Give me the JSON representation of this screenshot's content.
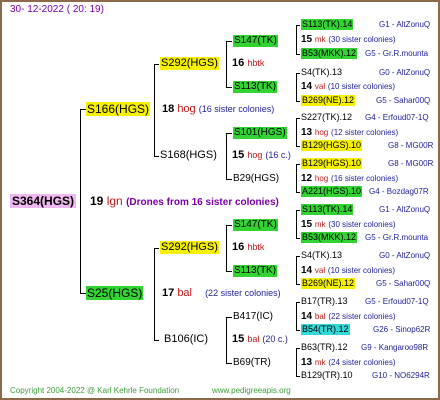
{
  "header": {
    "date": "30- 12-2022 ( 20: 19)"
  },
  "footer": {
    "copyright": "Copyright 2004-2022 @ Karl Kehrle Foundation",
    "website": "www.pedigreeapis.org"
  },
  "root": {
    "id": "S364(HGS)",
    "gen": "19",
    "code": "lgn",
    "note": "(Drones from 16 sister colonies)"
  },
  "gen1": [
    {
      "id": "S166(HGS)",
      "num": "18",
      "code": "hog",
      "note": "(16 sister colonies)"
    },
    {
      "id": "S25(HGS)",
      "num": "17",
      "code": "bal",
      "note": "(22 sister colonies)"
    }
  ],
  "gen2": [
    {
      "id": "S292(HGS)",
      "num": "16",
      "code": "hbtk",
      "note": ""
    },
    {
      "id": "S168(HGS)",
      "num": "15",
      "code": "hog",
      "note": "(16 c.)"
    },
    {
      "id": "S292(HGS)",
      "num": "16",
      "code": "hbtk",
      "note": ""
    },
    {
      "id": "B106(IC)",
      "num": "15",
      "code": "bal",
      "note": "(20 c.)"
    }
  ],
  "gen3": [
    {
      "id": "S147(TK)",
      "num": "15",
      "code": "mk",
      "note": "(30 sister colonies)"
    },
    {
      "id": "S113(TK)",
      "num": "14",
      "code": "val",
      "note": "(10 sister colonies)"
    },
    {
      "id": "S101(HGS)",
      "num": "13",
      "code": "hog",
      "note": "(12 sister colonies)"
    },
    {
      "id": "B29(HGS)",
      "num": "12",
      "code": "hog",
      "note": "(16 sister colonies)"
    },
    {
      "id": "S147(TK)",
      "num": "15",
      "code": "mk",
      "note": "(30 sister colonies)"
    },
    {
      "id": "S113(TK)",
      "num": "14",
      "code": "val",
      "note": "(10 sister colonies)"
    },
    {
      "id": "B417(IC)",
      "num": "14",
      "code": "bal",
      "note": "(22 sister colonies)"
    },
    {
      "id": "B69(TR)",
      "num": "13",
      "code": "mk",
      "note": "(24 sister colonies)"
    }
  ],
  "gen4": [
    {
      "id": "S113(TK).14",
      "right": "G1 - AltZonuQ"
    },
    {
      "id": "B53(MKK).12",
      "right": "G5 - Gr.R.mounta"
    },
    {
      "id": "S4(TK).13",
      "right": "G0 - AltZonuQ"
    },
    {
      "id": "B269(NE).12",
      "right": "G5 - Sahar00Q"
    },
    {
      "id": "S227(TK).12",
      "right": "G4 - Erfoud07-1Q"
    },
    {
      "id": "B129(HGS).10",
      "right": "G8 - MG00R"
    },
    {
      "id": "B129(HGS).10",
      "right": "G8 - MG00R"
    },
    {
      "id": "A221(HGS).10",
      "right": "G4 - Bozdag07R"
    },
    {
      "id": "S113(TK).14",
      "right": "G1 - AltZonuQ"
    },
    {
      "id": "B53(MKK).12",
      "right": "G5 - Gr.R.mounta"
    },
    {
      "id": "S4(TK).13",
      "right": "G0 - AltZonuQ"
    },
    {
      "id": "B269(NE).12",
      "right": "G5 - Sahar00Q"
    },
    {
      "id": "B17(TR).13",
      "right": "G5 - Erfoud07-1Q"
    },
    {
      "id": "B54(TR).12",
      "right": "G26 - Sinop62R"
    },
    {
      "id": "B63(TR).12",
      "right": "G9 - Kangaroo98R"
    },
    {
      "id": "B129(TR).10",
      "right": "G10 - NO6294R"
    }
  ],
  "colors": {
    "green": "#33d333",
    "yellow": "#f4f000",
    "cyan": "#33d8d8",
    "pink": "#f0b8f0",
    "border": "#8b6a4b"
  }
}
